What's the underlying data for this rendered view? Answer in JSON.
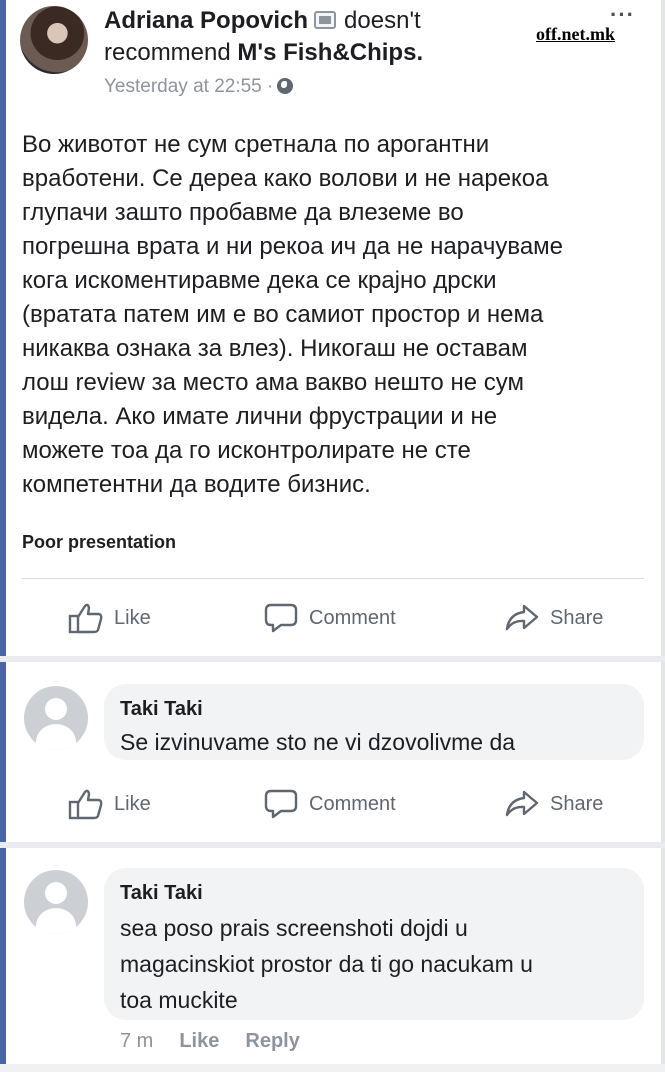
{
  "post": {
    "author": "Adriana Popovich",
    "action_text": "doesn't",
    "recommend_word": "recommend",
    "page_name": "M's Fish&Chips.",
    "timestamp": "Yesterday at 22:55 ·",
    "body": "Во животот не сум сретнала по арогантни\nвработени. Се дереа како волови и не нарекоа\nглупачи зашто пробавме да влеземе во\nпогрешна врата и ни рекоа ич да не нарачуваме\nкога искоментиравме дека се крајно дрски\n(вратата патем им е во самиот простор и нема\nникаква ознака за влез). Никогаш не оставам\nлош review за место ама вакво нешто не сум\nвидела. Ако имате лични фрустрации и не\nможете тоа да го исконтролирате не сте\nкомпетентни да водите бизнис.",
    "tag": "Poor presentation",
    "more_icon": "···"
  },
  "watermark": "off.net.mk",
  "actions": {
    "like": "Like",
    "comment": "Comment",
    "share": "Share"
  },
  "comments": [
    {
      "name": "Taki Taki",
      "text": "Se izvinuvame sto ne vi dzovolivme da"
    },
    {
      "name": "Taki Taki",
      "text": "sea poso prais screenshoti dojdi u\nmagacinskiot prostor da ti go nacukam u\ntoa muckite"
    }
  ],
  "comment_meta": {
    "time": "7 m",
    "like": "Like",
    "reply": "Reply"
  },
  "colors": {
    "frame": "#4a64a8",
    "text": "#1c1e21",
    "muted": "#606770",
    "bubble": "#f2f3f5"
  }
}
